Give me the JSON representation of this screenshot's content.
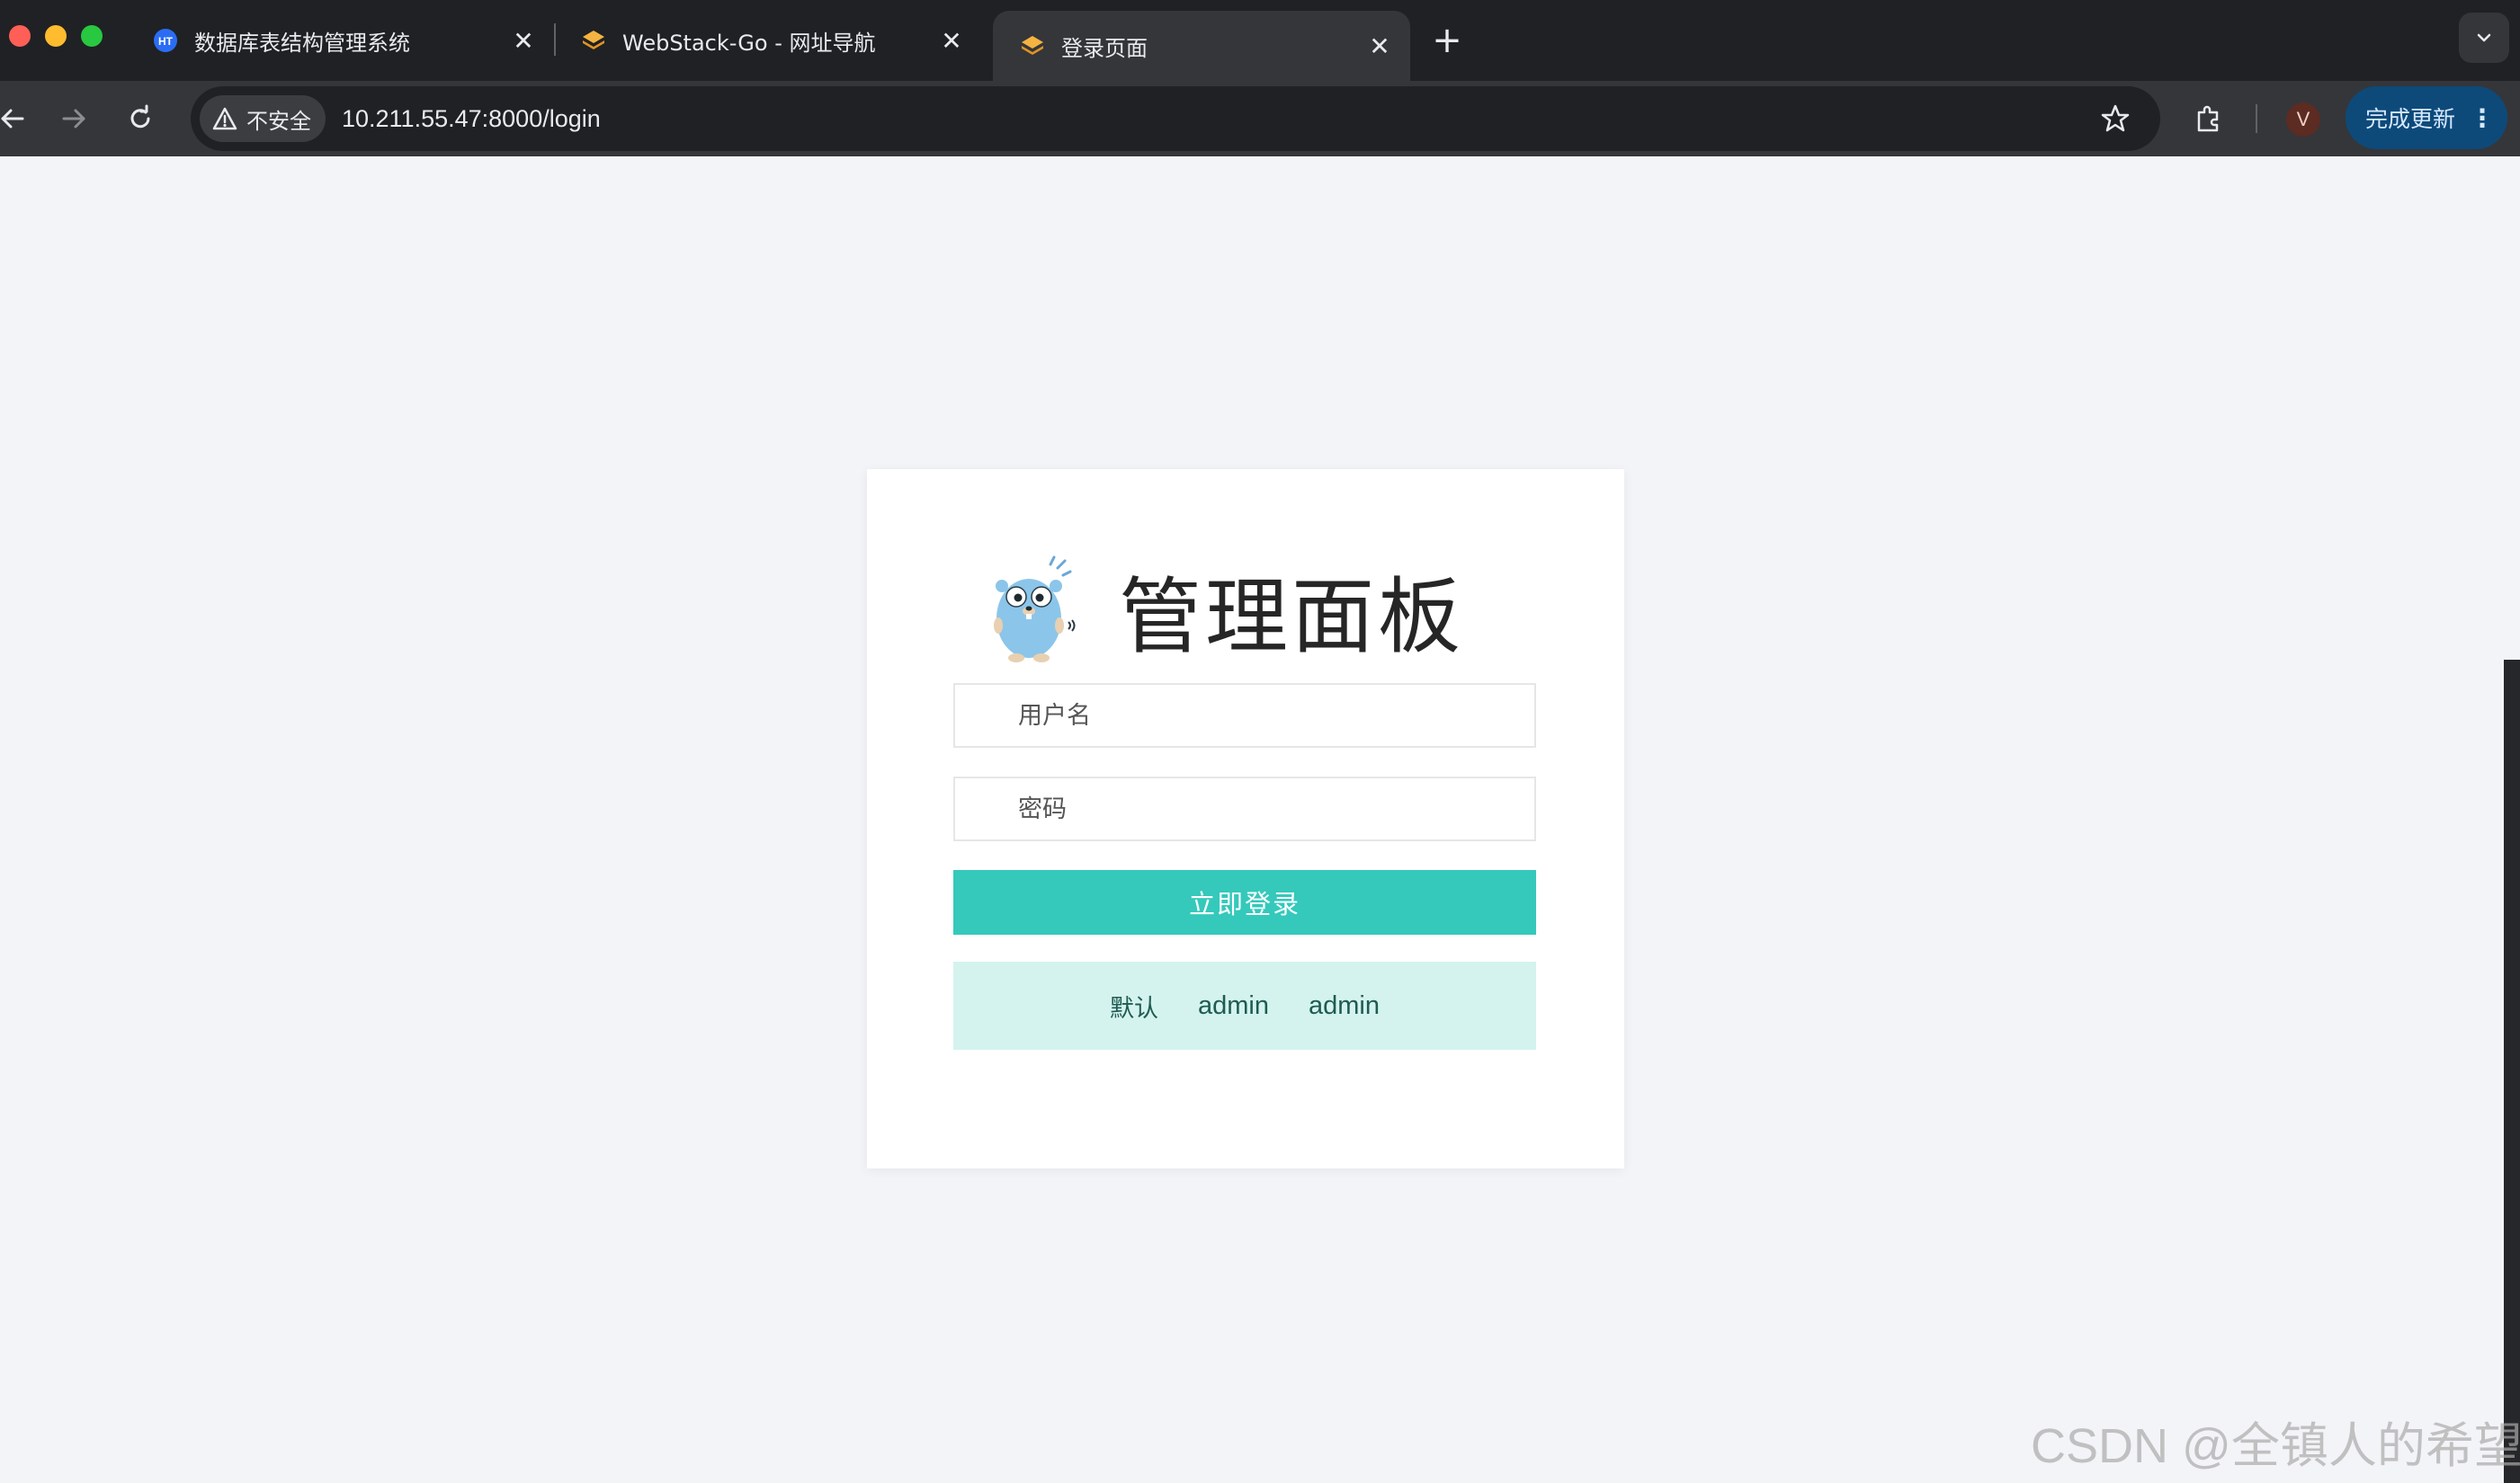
{
  "browser": {
    "tabs": [
      {
        "title": "数据库表结构管理系统",
        "favicon": "ht-logo-icon",
        "active": false
      },
      {
        "title": "WebStack-Go - 网址导航",
        "favicon": "webstack-logo-icon",
        "active": false
      },
      {
        "title": "登录页面",
        "favicon": "webstack-logo-icon",
        "active": true
      }
    ],
    "address_chip": "不安全",
    "url": "10.211.55.47:8000/login",
    "profile_initial": "V",
    "update_label": "完成更新"
  },
  "login": {
    "title": "管理面板",
    "username_placeholder": "用户名",
    "password_placeholder": "密码",
    "submit_label": "立即登录",
    "hint": {
      "label": "默认",
      "username": "admin",
      "password": "admin"
    }
  },
  "watermark": "CSDN @全镇人的希望",
  "colors": {
    "accent": "#34c9bb",
    "hint_bg": "#d4f3ef",
    "page_bg": "#f3f4f8"
  }
}
